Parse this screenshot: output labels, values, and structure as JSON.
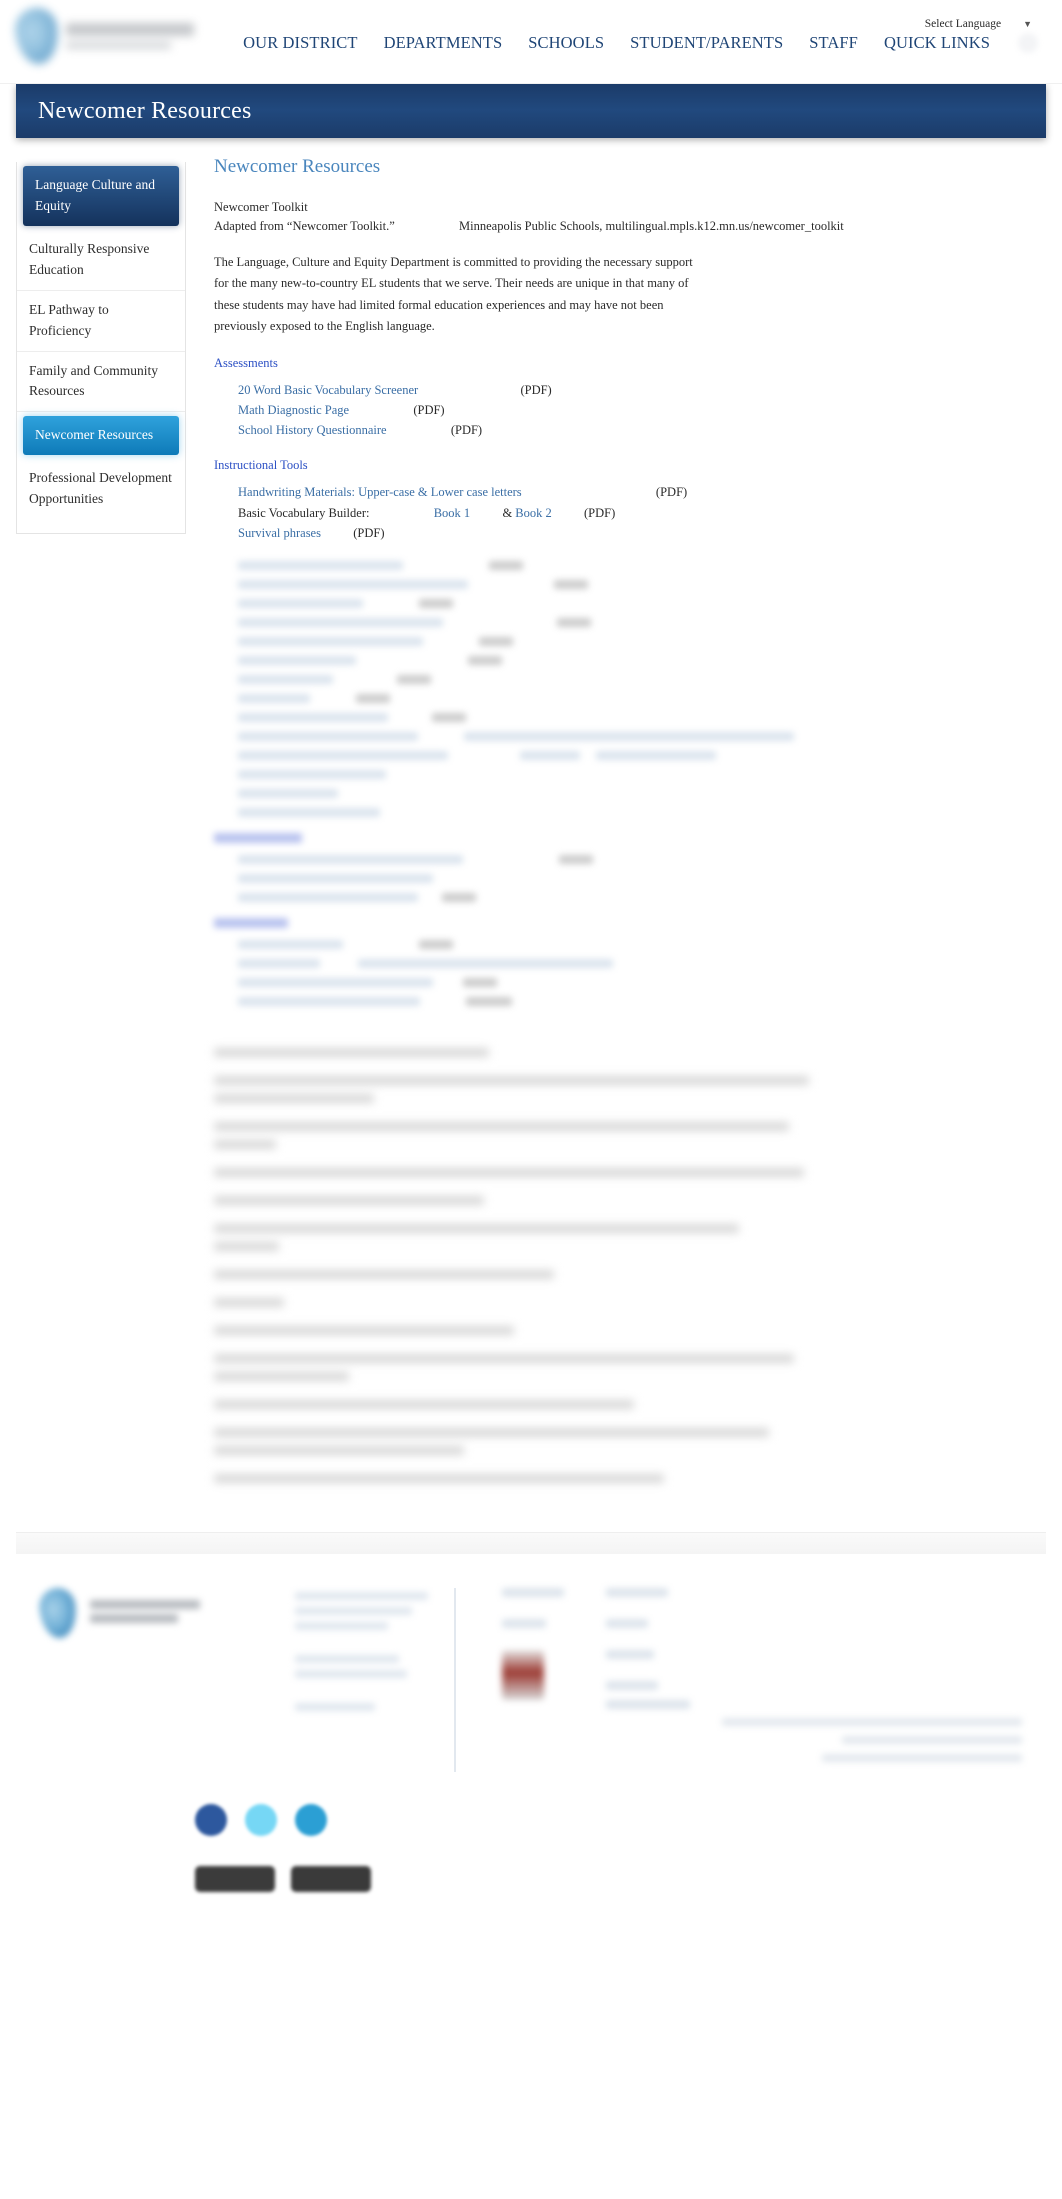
{
  "header": {
    "language_selector_label": "Select Language",
    "language_caret": "▼",
    "nav": [
      {
        "label": "OUR DISTRICT"
      },
      {
        "label": "DEPARTMENTS"
      },
      {
        "label": "SCHOOLS"
      },
      {
        "label": "STUDENT/PARENTS"
      },
      {
        "label": "STAFF"
      },
      {
        "label": "QUICK LINKS"
      }
    ],
    "search_icon": "search-icon"
  },
  "banner": {
    "title": "Newcomer Resources"
  },
  "sidebar": {
    "items": [
      {
        "label": "Language Culture and Equity",
        "state": "active-dark"
      },
      {
        "label": "Culturally Responsive Education",
        "state": "normal"
      },
      {
        "label": "EL Pathway to Proficiency",
        "state": "normal"
      },
      {
        "label": "Family and Community Resources",
        "state": "normal"
      },
      {
        "label": "Newcomer Resources",
        "state": "active-blue"
      },
      {
        "label": "Professional Development Opportunities",
        "state": "normal"
      }
    ]
  },
  "main": {
    "page_title": "Newcomer Resources",
    "toolkit_title": "Newcomer Toolkit",
    "toolkit_credit_a": "Adapted from “Newcomer Toolkit.”",
    "toolkit_credit_b": "Minneapolis Public Schools, multilingual.mpls.k12.mn.us/newcomer_toolkit",
    "intro_paragraph": "The Language, Culture and Equity Department is committed to providing the necessary support for the many new-to-country EL students that we serve. Their needs are unique in that many of these students may have had limited formal education experiences and may have not been previously exposed to the English language.",
    "sections": [
      {
        "heading": "Assessments",
        "items": [
          {
            "link": "20 Word Basic Vocabulary Screener",
            "pdf": "(PDF)",
            "gap": "sp-lg"
          },
          {
            "link": "Math Diagnostic Page",
            "pdf": "(PDF)",
            "gap": "sp-md"
          },
          {
            "link": "School History Questionnaire",
            "pdf": "(PDF)",
            "gap": "sp-md"
          }
        ]
      },
      {
        "heading": "Instructional Tools",
        "items": [
          {
            "link": "Handwriting Materials: Upper-case & Lower case letters",
            "pdf": "(PDF)",
            "gap": "sp-xl"
          },
          {
            "plain": "Basic Vocabulary Builder:",
            "link": "Book 1",
            "conj": "&",
            "link2": "Book 2",
            "pdf": "(PDF)",
            "gap": "sp-md"
          },
          {
            "link": "Survival phrases",
            "pdf": "(PDF)",
            "gap": "sp-sm"
          }
        ]
      }
    ]
  },
  "colors": {
    "banner_navy": "#1b3b69",
    "nav_navy": "#1f4576",
    "heading_blue": "#4a86bd",
    "section_blue": "#2b4fc4",
    "link_blue": "#3a6ea5",
    "sidebar_active_blue": "#0e7ab8",
    "sidebar_active_navy": "#14325c"
  },
  "footer": {
    "social": [
      {
        "name": "facebook-icon"
      },
      {
        "name": "twitter-icon"
      },
      {
        "name": "instagram-icon"
      }
    ],
    "app_badges": [
      {
        "name": "app-store-badge"
      },
      {
        "name": "google-play-badge"
      }
    ]
  }
}
